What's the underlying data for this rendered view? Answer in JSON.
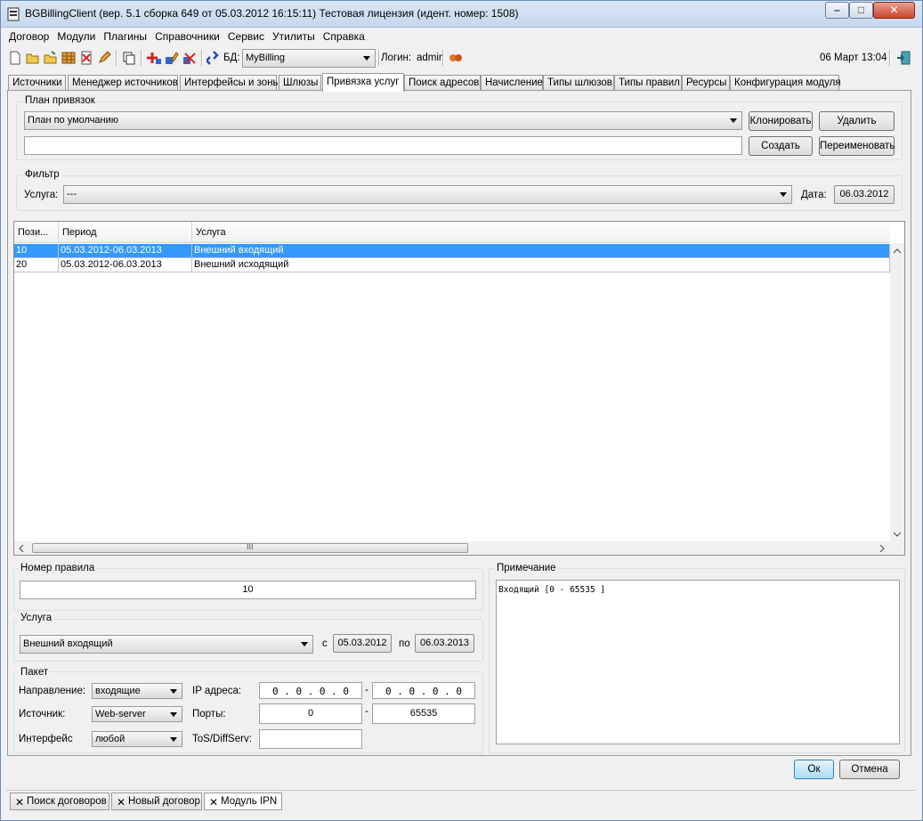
{
  "window": {
    "title": "BGBillingClient (вер. 5.1 сборка 649 от 05.03.2012 16:15:11) Тестовая лицензия (идент. номер: 1508)",
    "minimize": "–",
    "maximize": "□",
    "close": "✕"
  },
  "menubar": [
    "Договор",
    "Модули",
    "Плагины",
    "Справочники",
    "Сервис",
    "Утилиты",
    "Справка"
  ],
  "toolbar": {
    "db_label": "БД:",
    "db_value": "MyBilling",
    "login_label": "Логин:",
    "login_value": "admin",
    "datetime": "06 Март 13:04"
  },
  "tabs": [
    "Источники",
    "Менеджер источников",
    "Интерфейсы и зоны",
    "Шлюзы",
    "Привязка услуг",
    "Поиск адресов",
    "Начисление",
    "Типы шлюзов",
    "Типы правил",
    "Ресурсы",
    "Конфигурация модуля"
  ],
  "plan": {
    "title": "План привязок",
    "selected": "План по умолчанию",
    "name_value": "",
    "clone": "Клонировать",
    "delete": "Удалить",
    "create": "Создать",
    "rename": "Переименовать"
  },
  "filter": {
    "title": "Фильтр",
    "service_label": "Услуга:",
    "service_value": "---",
    "date_label": "Дата:",
    "date_value": "06.03.2012"
  },
  "table": {
    "columns": [
      "Пози...",
      "Период",
      "Услуга"
    ],
    "rows": [
      {
        "pos": "10",
        "period": "05.03.2012-06.03.2013",
        "service": "Внешний входящий",
        "selected": true
      },
      {
        "pos": "20",
        "period": "05.03.2012-06.03.2013",
        "service": "Внешний исходящий",
        "selected": false
      }
    ],
    "hscroll_grip": "III"
  },
  "rule": {
    "title": "Номер правила",
    "value": "10"
  },
  "service": {
    "title": "Услуга",
    "value": "Внешний входящий",
    "from_label": "с",
    "from_date": "05.03.2012",
    "to_label": "по",
    "to_date": "06.03.2013"
  },
  "packet": {
    "title": "Пакет",
    "direction_label": "Направление:",
    "direction_value": "входящие",
    "source_label": "Источник:",
    "source_value": "Web-server",
    "iface_label": "Интерфейс",
    "iface_value": "любой",
    "ip_label": "IP адреса:",
    "ip_from": "0 . 0 . 0 . 0",
    "ip_to": "0 . 0 . 0 . 0",
    "dash": "-",
    "ports_label": "Порты:",
    "port_from": "0",
    "port_to": "65535",
    "tos_label": "ToS/DiffServ:",
    "tos_value": ""
  },
  "note": {
    "title": "Примечание",
    "text": "Входящий [0 - 65535 ]"
  },
  "actions": {
    "ok": "Ок",
    "cancel": "Отмена"
  },
  "bottom_tabs": [
    "Поиск договоров",
    "Новый договор",
    "Модуль IPN"
  ],
  "colors": {
    "selection": "#3399ff",
    "titlebar": "#c7d7ec"
  }
}
